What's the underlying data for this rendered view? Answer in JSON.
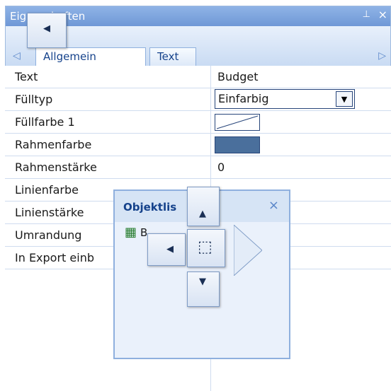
{
  "panel": {
    "title": "Eigenschaften",
    "pin_glyph": "⊥",
    "close_glyph": "×",
    "tabs": [
      {
        "label": "Allgemein"
      },
      {
        "label": "Text"
      }
    ],
    "tab_left_arrow": "◁",
    "tab_right_arrow": "▷"
  },
  "properties": [
    {
      "name": "Text",
      "value": "Budget"
    },
    {
      "name": "Fülltyp",
      "value": "Einfarbig"
    },
    {
      "name": "Füllfarbe 1",
      "value": ""
    },
    {
      "name": "Rahmenfarbe",
      "value": ""
    },
    {
      "name": "Rahmenstärke",
      "value": "0"
    },
    {
      "name": "Linienfarbe",
      "value": ""
    },
    {
      "name": "Linienstärke",
      "value": ""
    },
    {
      "name": "Umrandung",
      "value": ""
    },
    {
      "name": "In Export einb",
      "value": ""
    }
  ],
  "fill_dropdown_arrow": "▼",
  "object_list": {
    "title": "Objektlis",
    "close": "×",
    "item_text": "B",
    "item_icon": "excel-chart-icon"
  },
  "dock_guides": {
    "glyph_up": "▲",
    "glyph_down": "▼",
    "glyph_left": "◀",
    "glyph_center": "⬚"
  },
  "colors": {
    "title_bar": "#6f98d6",
    "panel_bg": "#d6e4f5",
    "accent_text": "#15428b",
    "border_swatch": "#4a6f9c"
  }
}
